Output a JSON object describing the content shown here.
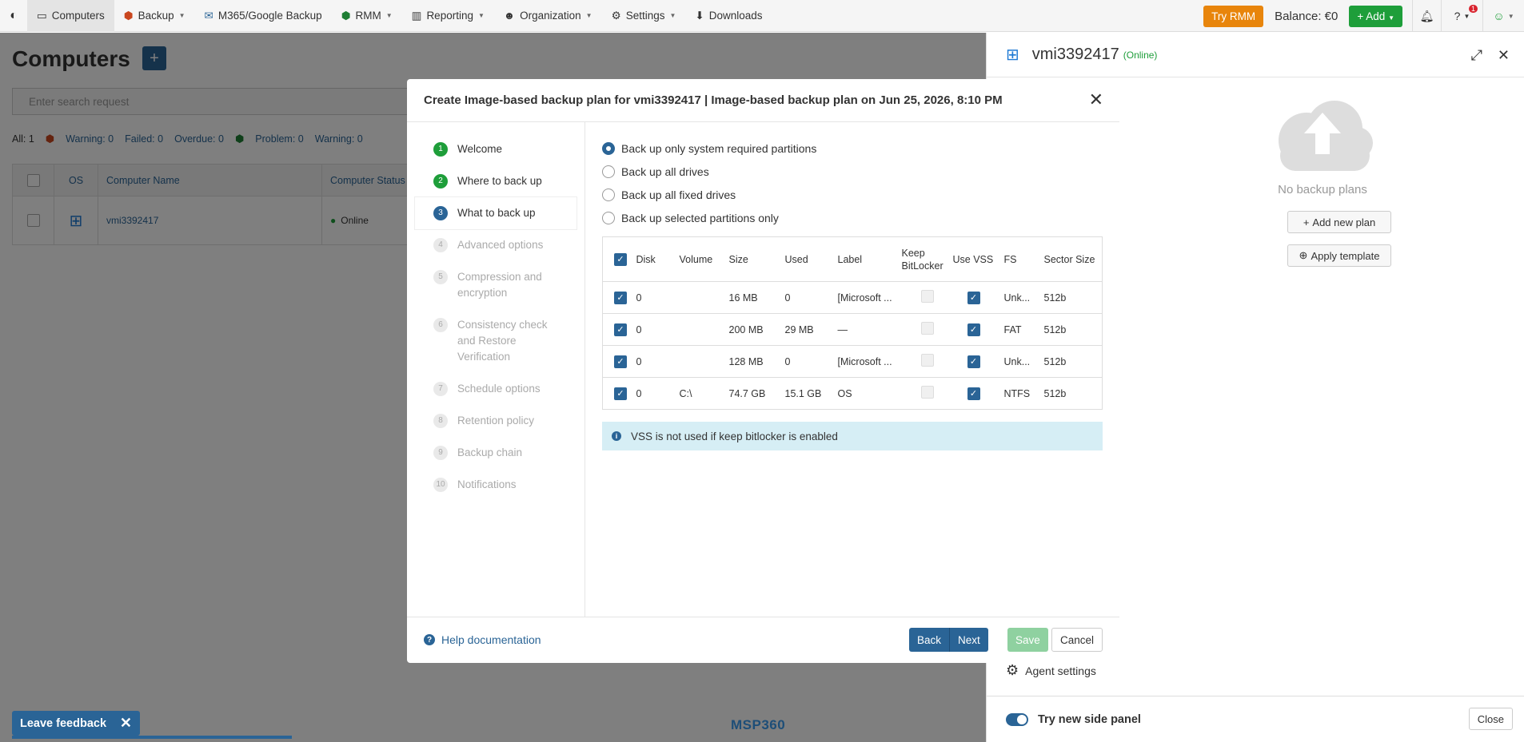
{
  "nav": {
    "items": [
      {
        "label": "Computers",
        "icon": "monitor-icon",
        "caret": false,
        "active": true
      },
      {
        "label": "Backup",
        "icon": "backup-icon",
        "caret": true
      },
      {
        "label": "M365/Google Backup",
        "icon": "mail-icon",
        "caret": false
      },
      {
        "label": "RMM",
        "icon": "rmm-icon",
        "caret": true
      },
      {
        "label": "Reporting",
        "icon": "chart-icon",
        "caret": true
      },
      {
        "label": "Organization",
        "icon": "users-icon",
        "caret": true
      },
      {
        "label": "Settings",
        "icon": "gear-icon",
        "caret": true
      },
      {
        "label": "Downloads",
        "icon": "download-icon",
        "caret": false
      }
    ],
    "try_rmm": "Try RMM",
    "balance": "Balance: €0",
    "add": "Add",
    "notification_count": "1"
  },
  "page": {
    "title": "Computers",
    "search_placeholder": "Enter search request",
    "summary": {
      "all": "All: 1",
      "backup_warning": "Warning: 0",
      "failed": "Failed: 0",
      "overdue": "Overdue: 0",
      "problem": "Problem: 0",
      "rmm_warning": "Warning: 0"
    },
    "table": {
      "headers": [
        "OS",
        "Computer Name",
        "Computer Status ↑"
      ],
      "rows": [
        {
          "name": "vmi3392417",
          "status": "Online"
        }
      ]
    }
  },
  "side_panel": {
    "title": "vmi3392417",
    "status": "(Online)",
    "no_plans": "No backup plans",
    "add_plan": "Add new plan",
    "apply_template": "Apply template",
    "agent_settings": "Agent settings",
    "try_new": "Try new side panel",
    "close": "Close"
  },
  "modal": {
    "title": "Create Image-based backup plan for vmi3392417 | Image-based backup plan on Jun 25, 2026, 8:10 PM",
    "steps": [
      {
        "n": "1",
        "label": "Welcome",
        "state": "done"
      },
      {
        "n": "2",
        "label": "Where to back up",
        "state": "done"
      },
      {
        "n": "3",
        "label": "What to back up",
        "state": "current"
      },
      {
        "n": "4",
        "label": "Advanced options",
        "state": "todo"
      },
      {
        "n": "5",
        "label": "Compression and encryption",
        "state": "todo"
      },
      {
        "n": "6",
        "label": "Consistency check and Restore Verification",
        "state": "todo"
      },
      {
        "n": "7",
        "label": "Schedule options",
        "state": "todo"
      },
      {
        "n": "8",
        "label": "Retention policy",
        "state": "todo"
      },
      {
        "n": "9",
        "label": "Backup chain",
        "state": "todo"
      },
      {
        "n": "10",
        "label": "Notifications",
        "state": "todo"
      }
    ],
    "radio_options": [
      {
        "label": "Back up only system required partitions",
        "selected": true
      },
      {
        "label": "Back up all drives",
        "selected": false
      },
      {
        "label": "Back up all fixed drives",
        "selected": false
      },
      {
        "label": "Back up selected partitions only",
        "selected": false
      }
    ],
    "partition_headers": [
      "Disk",
      "Volume",
      "Size",
      "Used",
      "Label",
      "Keep BitLocker",
      "Use VSS",
      "FS",
      "Sector Size"
    ],
    "partitions": [
      {
        "disk": "0",
        "volume": "",
        "size": "16 MB",
        "used": "0",
        "label": "[Microsoft ...",
        "fs": "Unk...",
        "sector": "512b"
      },
      {
        "disk": "0",
        "volume": "",
        "size": "200 MB",
        "used": "29 MB",
        "label": "—",
        "fs": "FAT",
        "sector": "512b"
      },
      {
        "disk": "0",
        "volume": "",
        "size": "128 MB",
        "used": "0",
        "label": "[Microsoft ...",
        "fs": "Unk...",
        "sector": "512b"
      },
      {
        "disk": "0",
        "volume": "C:\\",
        "size": "74.7 GB",
        "used": "15.1 GB",
        "label": "OS",
        "fs": "NTFS",
        "sector": "512b"
      }
    ],
    "info": "VSS is not used if keep bitlocker is enabled",
    "help": "Help documentation",
    "back": "Back",
    "next": "Next",
    "save": "Save",
    "cancel": "Cancel"
  },
  "footer": {
    "brand": "MSP360",
    "feedback": "Leave feedback"
  },
  "colors": {
    "primary": "#2a6496",
    "success": "#1e9e3a",
    "orange": "#e8850c",
    "info_bg": "#d6eef5"
  }
}
